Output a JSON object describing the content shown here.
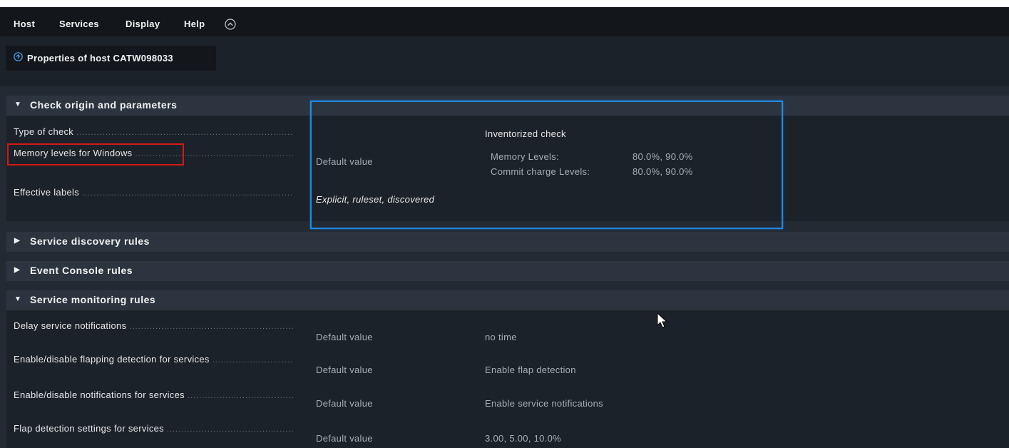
{
  "menu": {
    "items": [
      "Host",
      "Services",
      "Display",
      "Help"
    ],
    "collapse_icon": "chevron-up-circle-icon"
  },
  "title": {
    "text": "Properties of host CATW098033",
    "icon": "circle-arrow-up-icon"
  },
  "sections": {
    "check_origin": {
      "label": "Check origin and parameters",
      "expanded": true,
      "rows": {
        "type_of_check": {
          "label": "Type of check",
          "value": "Inventorized check"
        },
        "memory_levels": {
          "label": "Memory levels for Windows",
          "default": "Default value",
          "params": {
            "memory_key": "Memory Levels:",
            "memory_val": "80.0%, 90.0%",
            "commit_key": "Commit charge Levels:",
            "commit_val": "80.0%, 90.0%"
          }
        },
        "effective_labels": {
          "label": "Effective labels",
          "value": "Explicit, ruleset, discovered"
        }
      }
    },
    "service_discovery": {
      "label": "Service discovery rules",
      "expanded": false
    },
    "event_console": {
      "label": "Event Console rules",
      "expanded": false
    },
    "service_monitoring": {
      "label": "Service monitoring rules",
      "expanded": true,
      "rows": [
        {
          "label": "Delay service notifications",
          "default": "Default value",
          "value": "no time"
        },
        {
          "label": "Enable/disable flapping detection for services",
          "default": "Default value",
          "value": "Enable flap detection"
        },
        {
          "label": "Enable/disable notifications for services",
          "default": "Default value",
          "value": "Enable service notifications"
        },
        {
          "label": "Flap detection settings for services",
          "default": "Default value",
          "value": "3.00, 5.00, 10.0%"
        }
      ]
    }
  },
  "highlight_colors": {
    "blue": "#1e88e5",
    "red": "#d41818"
  }
}
